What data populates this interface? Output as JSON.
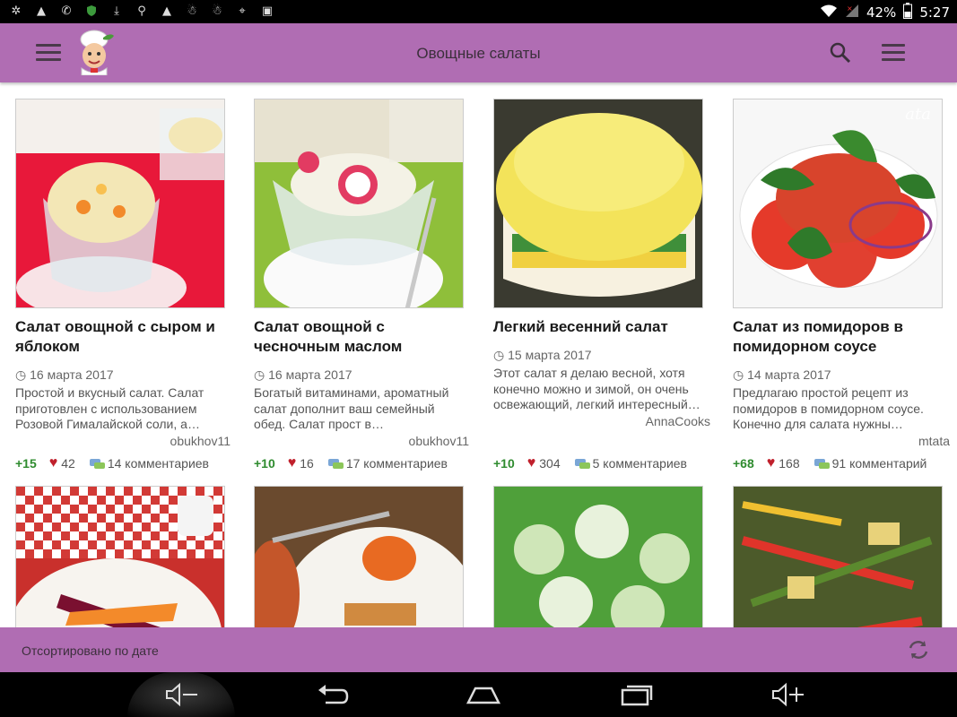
{
  "status_bar": {
    "battery": "42%",
    "time": "5:27",
    "icons": [
      "usb-debug-icon",
      "warning-icon",
      "viber-icon",
      "shield-icon",
      "download-icon",
      "search-icon",
      "warning-icon",
      "odnoklassniki-icon",
      "odnoklassniki-icon",
      "location-icon",
      "image-icon"
    ]
  },
  "app_bar": {
    "title": "Овощные салаты"
  },
  "colors": {
    "accent": "#b06db3",
    "score_green": "#2e8b2e",
    "heart_red": "#c0202c"
  },
  "recipes": [
    {
      "title": "Салат овощной с сыром и яблоком",
      "date": "16 марта 2017",
      "description": "Простой и вкусный салат. Салат приготовлен с использованием Розовой Гималайской соли, а…",
      "author": "obukhov11",
      "score": "+15",
      "likes": "42",
      "comments": "14 комментариев"
    },
    {
      "title": "Салат овощной с чесночным маслом",
      "date": "16 марта 2017",
      "description": "Богатый витаминами, ароматный салат дополнит ваш семейный обед. Салат прост в…",
      "author": "obukhov11",
      "score": "+10",
      "likes": "16",
      "comments": "17 комментариев"
    },
    {
      "title": "Легкий весенний салат",
      "date": "15 марта 2017",
      "description": "Этот салат я делаю весной, хотя конечно можно и зимой, он очень освежающий, легкий интересный…",
      "author": "AnnaCooks",
      "score": "+10",
      "likes": "304",
      "comments": "5 комментариев"
    },
    {
      "title": "Салат из помидоров в помидорном соусе",
      "date": "14 марта 2017",
      "description": "Предлагаю простой рецепт из помидоров в помидорном соусе. Конечно для салата нужны…",
      "author": "mtata",
      "score": "+68",
      "likes": "168",
      "comments": "91 комментарий",
      "watermark": "ata"
    }
  ],
  "sort_bar": {
    "label": "Отсортировано по дате"
  }
}
